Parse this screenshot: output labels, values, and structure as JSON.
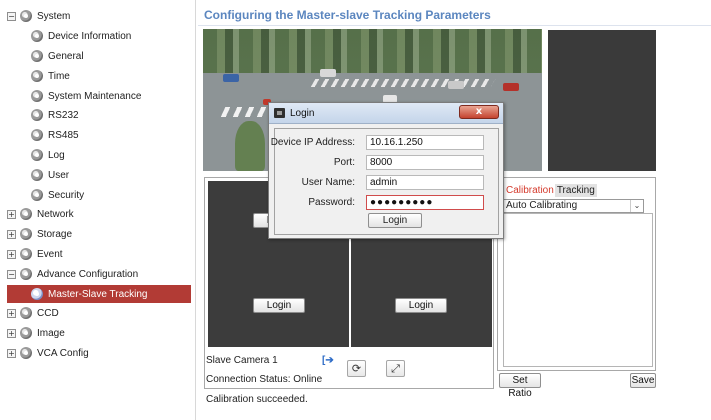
{
  "sidebar": {
    "items": [
      {
        "label": "System",
        "expander": "−"
      },
      {
        "label": "Device Information"
      },
      {
        "label": "General"
      },
      {
        "label": "Time"
      },
      {
        "label": "System Maintenance"
      },
      {
        "label": "RS232"
      },
      {
        "label": "RS485"
      },
      {
        "label": "Log"
      },
      {
        "label": "User"
      },
      {
        "label": "Security"
      },
      {
        "label": "Network",
        "expander": "+"
      },
      {
        "label": "Storage",
        "expander": "+"
      },
      {
        "label": "Event",
        "expander": "+"
      },
      {
        "label": "Advance Configuration",
        "expander": "−"
      },
      {
        "label": "Master-Slave Tracking"
      },
      {
        "label": "CCD",
        "expander": "+"
      },
      {
        "label": "Image",
        "expander": "+"
      },
      {
        "label": "VCA Config",
        "expander": "+"
      }
    ],
    "selected_index": 14,
    "selected_color": "#b23b35"
  },
  "main": {
    "title": "Configuring the Master-slave Tracking Parameters",
    "title_color": "#5b86bf",
    "grid": {
      "login_labels": [
        "Login",
        "Login",
        "Login"
      ]
    },
    "slave_camera_label": "Slave Camera 1",
    "exit_icon": "exit-icon",
    "refresh_icon": "refresh-icon",
    "expand_icon": "expand-icon",
    "connection_status": "Connection Status: Online",
    "calibration_message": "Calibration succeeded.",
    "tabs": [
      {
        "label": "Calibration",
        "active": true
      },
      {
        "label": "Tracking",
        "active": false
      }
    ],
    "calibration_mode": "Auto Calibrating",
    "set_ratio_label": "Set Ratio",
    "save_label": "Save"
  },
  "login_dialog": {
    "title": "Login",
    "close_glyph": "x",
    "fields": {
      "ip_label": "Device IP Address:",
      "ip_value": "10.16.1.250",
      "port_label": "Port:",
      "port_value": "8000",
      "user_label": "User Name:",
      "user_value": "admin",
      "password_label": "Password:",
      "password_value": "●●●●●●●●●"
    },
    "login_button": "Login"
  },
  "glyphs": {
    "expand_arrows": "⤢",
    "refresh": "⟳",
    "dropdown_arrow": "⌄",
    "exit": "[➔"
  }
}
